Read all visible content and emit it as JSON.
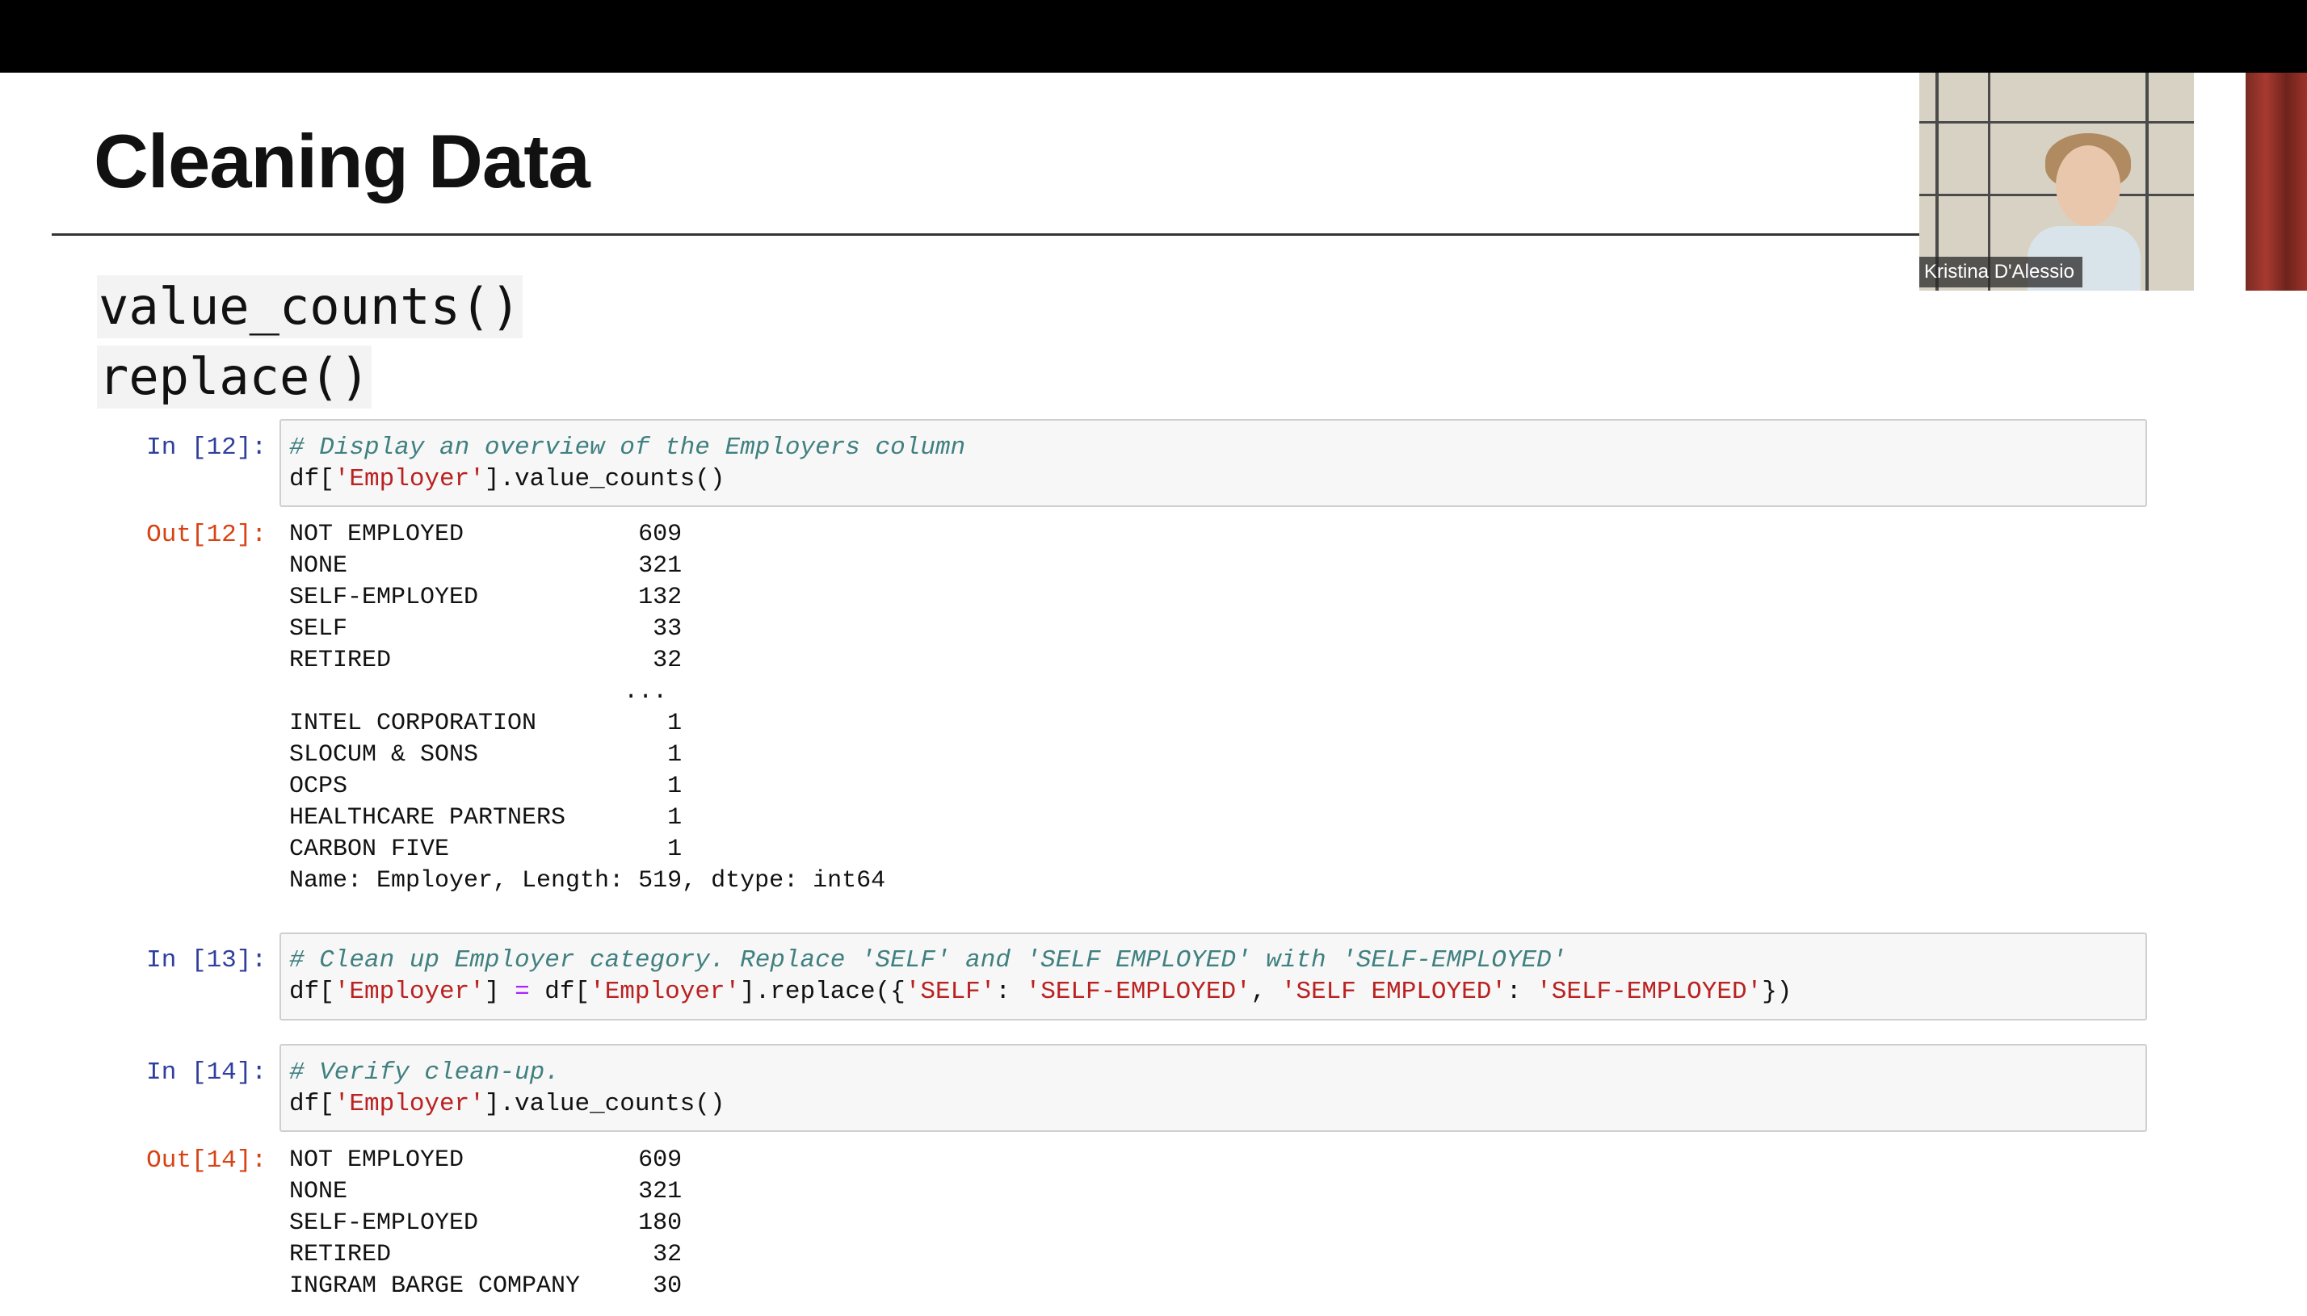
{
  "slide": {
    "title": "Cleaning Data",
    "functions": [
      "value_counts()",
      "replace()"
    ]
  },
  "cells": {
    "in12": {
      "prompt": "In [12]:",
      "comment": "# Display an overview of the Employers column",
      "code_pre": "df[",
      "code_str": "'Employer'",
      "code_post": "].value_counts()"
    },
    "out12": {
      "prompt": "Out[12]:",
      "text": "NOT EMPLOYED            609\nNONE                    321\nSELF-EMPLOYED           132\nSELF                     33\nRETIRED                  32\n                       ...\nINTEL CORPORATION         1\nSLOCUM & SONS             1\nOCPS                      1\nHEALTHCARE PARTNERS       1\nCARBON FIVE               1\nName: Employer, Length: 519, dtype: int64"
    },
    "in13": {
      "prompt": "In [13]:",
      "comment": "# Clean up Employer category. Replace 'SELF' and 'SELF EMPLOYED' with 'SELF-EMPLOYED'",
      "p1": "df[",
      "s1": "'Employer'",
      "p2": "] ",
      "op": "=",
      "p3": " df[",
      "s2": "'Employer'",
      "p4": "].replace({",
      "s3": "'SELF'",
      "p5": ": ",
      "s4": "'SELF-EMPLOYED'",
      "p6": ", ",
      "s5": "'SELF EMPLOYED'",
      "p7": ": ",
      "s6": "'SELF-EMPLOYED'",
      "p8": "})"
    },
    "in14": {
      "prompt": "In [14]:",
      "comment": "# Verify clean-up.",
      "code_pre": "df[",
      "code_str": "'Employer'",
      "code_post": "].value_counts()"
    },
    "out14": {
      "prompt": "Out[14]:",
      "text": "NOT EMPLOYED            609\nNONE                    321\nSELF-EMPLOYED           180\nRETIRED                  32\nINGRAM BARGE COMPANY     30"
    }
  },
  "video": {
    "participant_name": "Kristina D'Alessio"
  }
}
